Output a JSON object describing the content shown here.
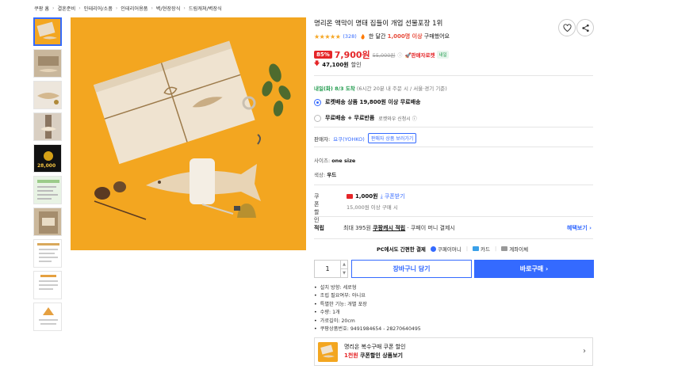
{
  "breadcrumb": [
    "쿠팡 홈",
    "결혼준비",
    "인테리어/소품",
    "인테리어용품",
    "벽/현장장식",
    "드림캐쳐/벽장식"
  ],
  "thumb_labels": {
    "t5": "28,000"
  },
  "product": {
    "title": "명리온 액막이 명태 집들이 개업 선물포장 1위",
    "stars": "★★★★★",
    "review_count": "(328)",
    "bought_prefix": "한 달간",
    "bought_count": "1,000명 이상",
    "bought_suffix": "구매했어요",
    "discount": "85%",
    "sale_price": "7,900원",
    "original_price": "55,000원",
    "seller_rocket": "판매자로켓",
    "seller_rocket_badge": "내일",
    "coupon_amount": "47,100원",
    "coupon_label": "할인"
  },
  "delivery": {
    "arrival": "내일(화) 8/3 도착",
    "note": "(6시간 20분 내 주문 시 / 서울·경기 기준)",
    "opt1_label": "로켓배송 상품 19,800원 이상 무료배송",
    "opt2_label": "무료배송 + 무료반품",
    "opt2_sub": "로켓와우 신청시 ⓘ"
  },
  "seller": {
    "label": "판매자:",
    "name": "요쿠(YOHKO)",
    "link": "판매자 상품 보러가기"
  },
  "options": {
    "size_label": "사이즈:",
    "size_value": "one size",
    "color_label": "색상:",
    "color_value": "우드"
  },
  "coupon": {
    "label": "쿠폰할인",
    "amount": "1,000원",
    "download": "쿠폰받기",
    "condition": "15,000원 이상 구매 시"
  },
  "points": {
    "label": "적립",
    "prefix": "최대 395원",
    "link": "쿠팡캐시 적립",
    "suffix": "· 쿠페이 머니 결제시",
    "more": "혜택보기 ›"
  },
  "payment": {
    "pc": "PC에서도 간편한 결제",
    "opt1": "쿠페이머니",
    "opt2": "카드",
    "opt3": "계좌이체"
  },
  "purchase": {
    "qty": "1",
    "cart": "장바구니 담기",
    "buy": "바로구매 ›"
  },
  "specs": [
    "설치 방향: 세로형",
    "조립 필요여부: 아니요",
    "특별한 기능: 개별 포장",
    "수량: 1개",
    "가로길이: 20cm",
    "쿠팡상품번호: 9491984654 - 28270640495"
  ],
  "banner": {
    "line1": "명리온 복수구매 쿠폰 할인",
    "line2_red": "1천원",
    "line2": "쿠폰할인 상품보기"
  },
  "colors": {
    "accent": "#346aff",
    "sale": "#e52528",
    "green": "#1f9a4c",
    "star": "#f5a623",
    "image_bg": "#f3a620"
  }
}
